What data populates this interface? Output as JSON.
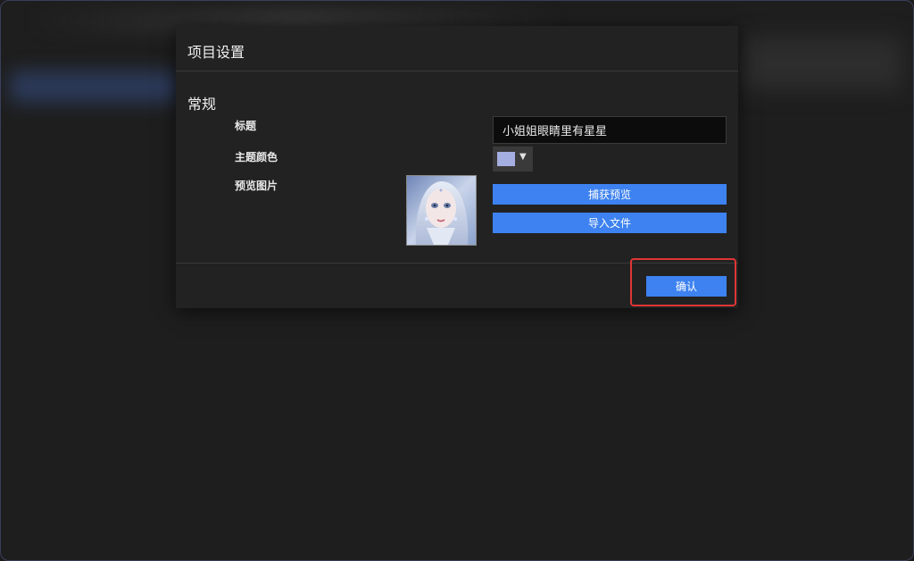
{
  "dialog": {
    "title": "项目设置",
    "section_title": "常规",
    "fields": {
      "title_label": "标题",
      "title_value": "小姐姐眼睛里有星星",
      "theme_color_label": "主题颜色",
      "theme_color_value": "#a4aee0",
      "preview_label": "预览图片"
    },
    "buttons": {
      "capture_preview": "捕获预览",
      "import_file": "导入文件",
      "confirm": "确认"
    }
  },
  "colors": {
    "accent": "#3d82f0",
    "highlight": "#e03535"
  }
}
